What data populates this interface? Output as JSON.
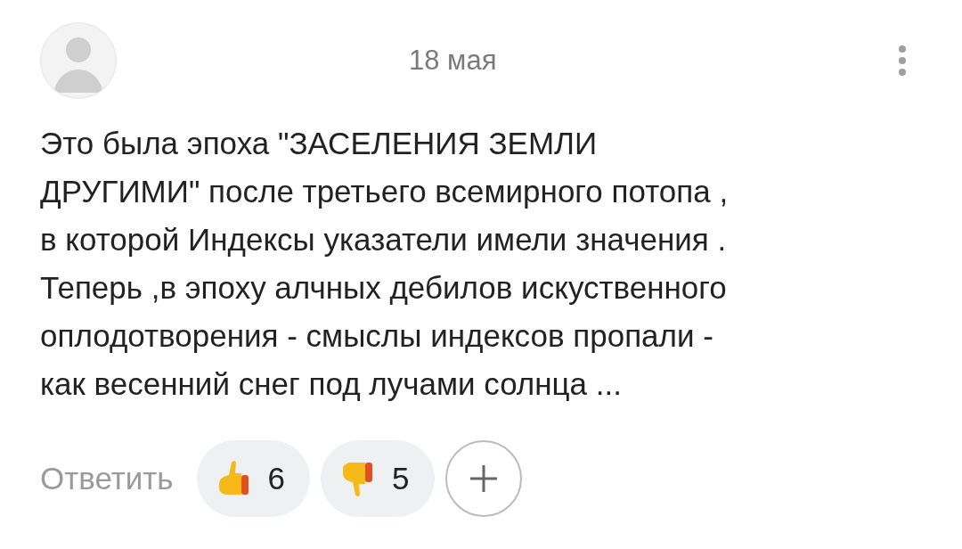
{
  "comment": {
    "date": "18 мая",
    "text": "Это была эпоха \"ЗАСЕЛЕНИЯ ЗЕМЛИ\nДРУГИМИ\" после третьего всемирного потопа ,\nв которой Индексы указатели имели значения .\nТеперь ,в эпоху алчных дебилов искуственного\nоплодотворения - смыслы индексов пропали -\nкак весенний снег под лучами солнца ...",
    "reply": "Ответить",
    "reactions": [
      {
        "kind": "like",
        "count": "6"
      },
      {
        "kind": "dislike",
        "count": "5"
      }
    ]
  }
}
